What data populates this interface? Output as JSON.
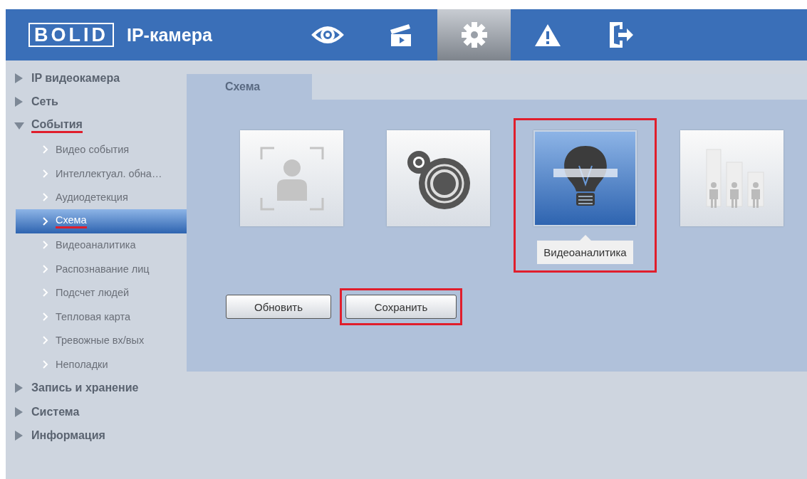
{
  "header": {
    "logo": "BOLID",
    "title": "IP-камера",
    "nav": [
      {
        "kind": "eye",
        "selected": false
      },
      {
        "kind": "clapper",
        "selected": false
      },
      {
        "kind": "gear",
        "selected": true
      },
      {
        "kind": "warning",
        "selected": false
      },
      {
        "kind": "exit",
        "selected": false
      }
    ]
  },
  "sidebar": {
    "items": [
      {
        "label": "IP видеокамера",
        "expanded": false,
        "marked": false
      },
      {
        "label": "Сеть",
        "expanded": false,
        "marked": false
      },
      {
        "label": "События",
        "expanded": true,
        "marked": true,
        "children": [
          {
            "label": "Видео события",
            "selected": false,
            "marked": false
          },
          {
            "label": "Интеллектуал. обна…",
            "selected": false,
            "marked": false
          },
          {
            "label": "Аудиодетекция",
            "selected": false,
            "marked": false
          },
          {
            "label": "Схема",
            "selected": true,
            "marked": true
          },
          {
            "label": "Видеоаналитика",
            "selected": false,
            "marked": false
          },
          {
            "label": "Распознавание лиц",
            "selected": false,
            "marked": false
          },
          {
            "label": "Подсчет людей",
            "selected": false,
            "marked": false
          },
          {
            "label": "Тепловая карта",
            "selected": false,
            "marked": false
          },
          {
            "label": "Тревожные вх/вых",
            "selected": false,
            "marked": false
          },
          {
            "label": "Неполадки",
            "selected": false,
            "marked": false
          }
        ]
      },
      {
        "label": "Запись и хранение",
        "expanded": false,
        "marked": false
      },
      {
        "label": "Система",
        "expanded": false,
        "marked": false
      },
      {
        "label": "Информация",
        "expanded": false,
        "marked": false
      }
    ]
  },
  "tabs": [
    {
      "label": "Схема",
      "selected": true
    }
  ],
  "scheme": {
    "tiles": [
      {
        "kind": "person",
        "selected": false,
        "highlighted": false
      },
      {
        "kind": "lens",
        "selected": false,
        "highlighted": false
      },
      {
        "kind": "bulb",
        "selected": true,
        "highlighted": true,
        "tooltip": "Видеоаналитика"
      },
      {
        "kind": "people",
        "selected": false,
        "highlighted": false
      }
    ]
  },
  "buttons": [
    {
      "label": "Обновить",
      "highlighted": false
    },
    {
      "label": "Сохранить",
      "highlighted": true
    }
  ]
}
